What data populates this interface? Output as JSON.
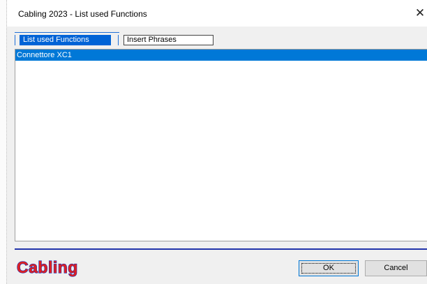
{
  "window": {
    "title": "Cabling 2023 - List used Functions"
  },
  "tabs": [
    {
      "label": "List used Functions",
      "active": true
    },
    {
      "label": "Insert Phrases",
      "active": false
    }
  ],
  "list": {
    "items": [
      {
        "label": "Connettore XC1",
        "selected": true
      }
    ]
  },
  "footer": {
    "logo_text": "Cabling",
    "ok_label": "OK",
    "cancel_label": "Cancel"
  },
  "colors": {
    "selection": "#0078d7",
    "tab_active": "#0063d6",
    "logo_red": "#e02020",
    "logo_blue": "#1a2bb5",
    "divider": "#2233aa"
  },
  "icons": {
    "close": "close-icon"
  }
}
